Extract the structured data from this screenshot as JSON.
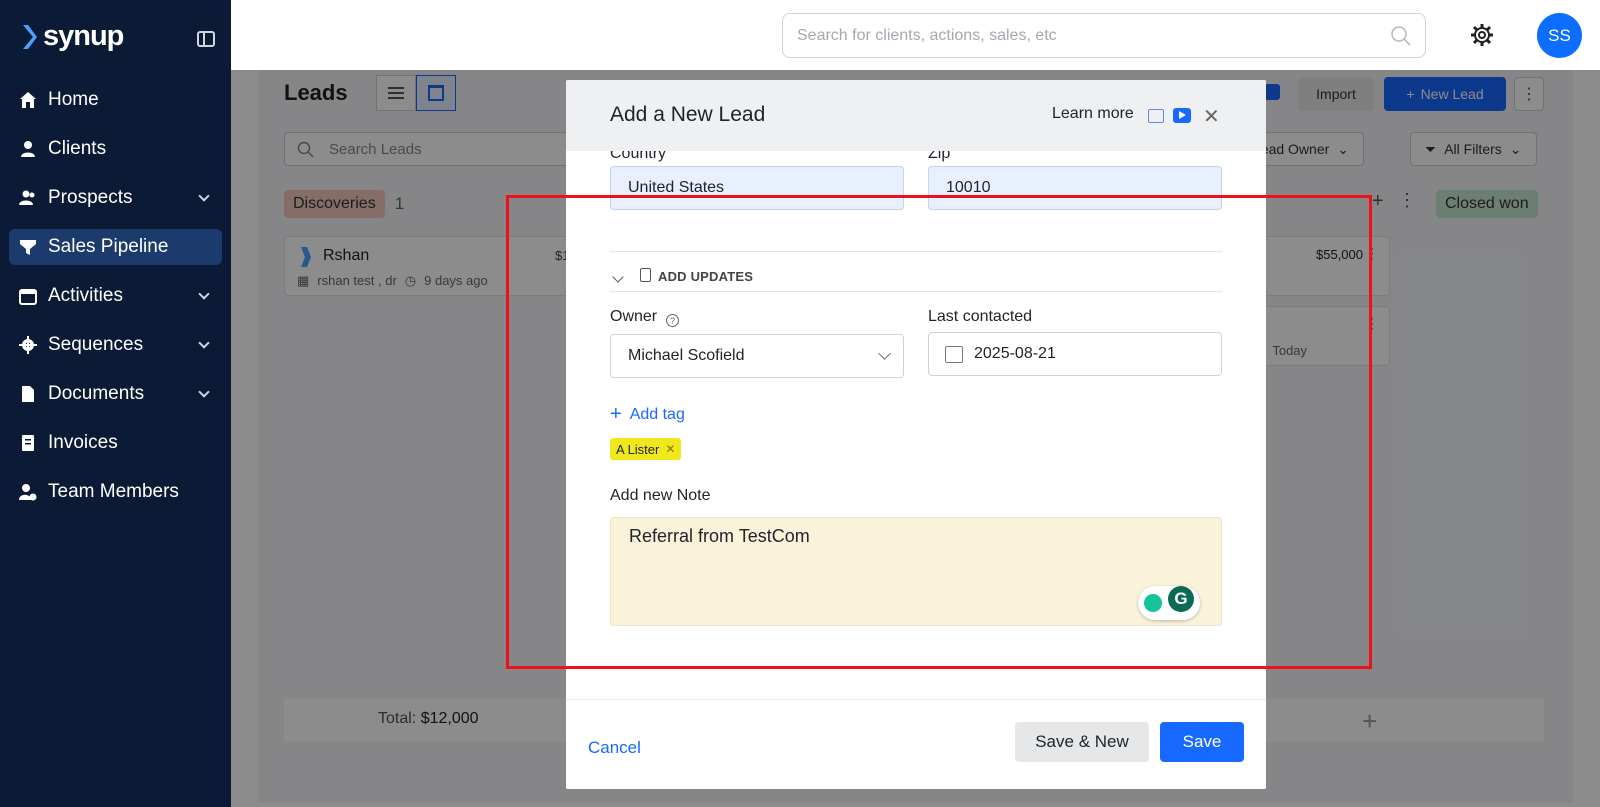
{
  "brand": {
    "name": "synup"
  },
  "sidebar": {
    "items": [
      {
        "label": "Home",
        "icon": "home-icon"
      },
      {
        "label": "Clients",
        "icon": "person-icon"
      },
      {
        "label": "Prospects",
        "icon": "people-icon"
      },
      {
        "label": "Sales Pipeline",
        "icon": "funnel-icon"
      },
      {
        "label": "Activities",
        "icon": "calendar-icon"
      },
      {
        "label": "Sequences",
        "icon": "gear-icon"
      },
      {
        "label": "Documents",
        "icon": "document-icon"
      },
      {
        "label": "Invoices",
        "icon": "receipt-icon"
      },
      {
        "label": "Team Members",
        "icon": "team-icon"
      }
    ],
    "active": "Sales Pipeline"
  },
  "topbar": {
    "search_placeholder": "Search for clients, actions, sales, etc",
    "avatar_initials": "SS"
  },
  "page": {
    "title": "Leads",
    "import_label": "Import",
    "new_lead_label": "New Lead",
    "search_placeholder": "Search Leads",
    "lead_owner_filter": "Lead Owner",
    "all_filters": "All Filters",
    "columns": [
      {
        "name": "Discoveries",
        "count": "1"
      },
      {
        "name": "Closed won",
        "count": ""
      }
    ],
    "cards": [
      {
        "name": "Rshan",
        "meta": "rshan test , dr",
        "time": "9 days ago",
        "amount": "$1"
      },
      {
        "amount": "$55,000"
      },
      {
        "time": "Today"
      }
    ],
    "total_label": "Total:",
    "total_value": "$12,000"
  },
  "modal": {
    "title": "Add a New Lead",
    "learn_more": "Learn more",
    "country_label": "Country",
    "country_value": "United States",
    "zip_label": "Zip",
    "zip_value": "10010",
    "section_title": "ADD UPDATES",
    "owner_label": "Owner",
    "owner_value": "Michael Scofield",
    "last_contacted_label": "Last contacted",
    "last_contacted_value": "2025-08-21",
    "add_tag_label": "Add tag",
    "tags": [
      "A Lister"
    ],
    "note_label": "Add new Note",
    "note_value": "Referral from TestCom",
    "cancel_label": "Cancel",
    "save_new_label": "Save & New",
    "save_label": "Save"
  },
  "colors": {
    "sidebar_bg": "#0b1b35",
    "accent": "#1769ff",
    "annotation": "#e8131d"
  }
}
